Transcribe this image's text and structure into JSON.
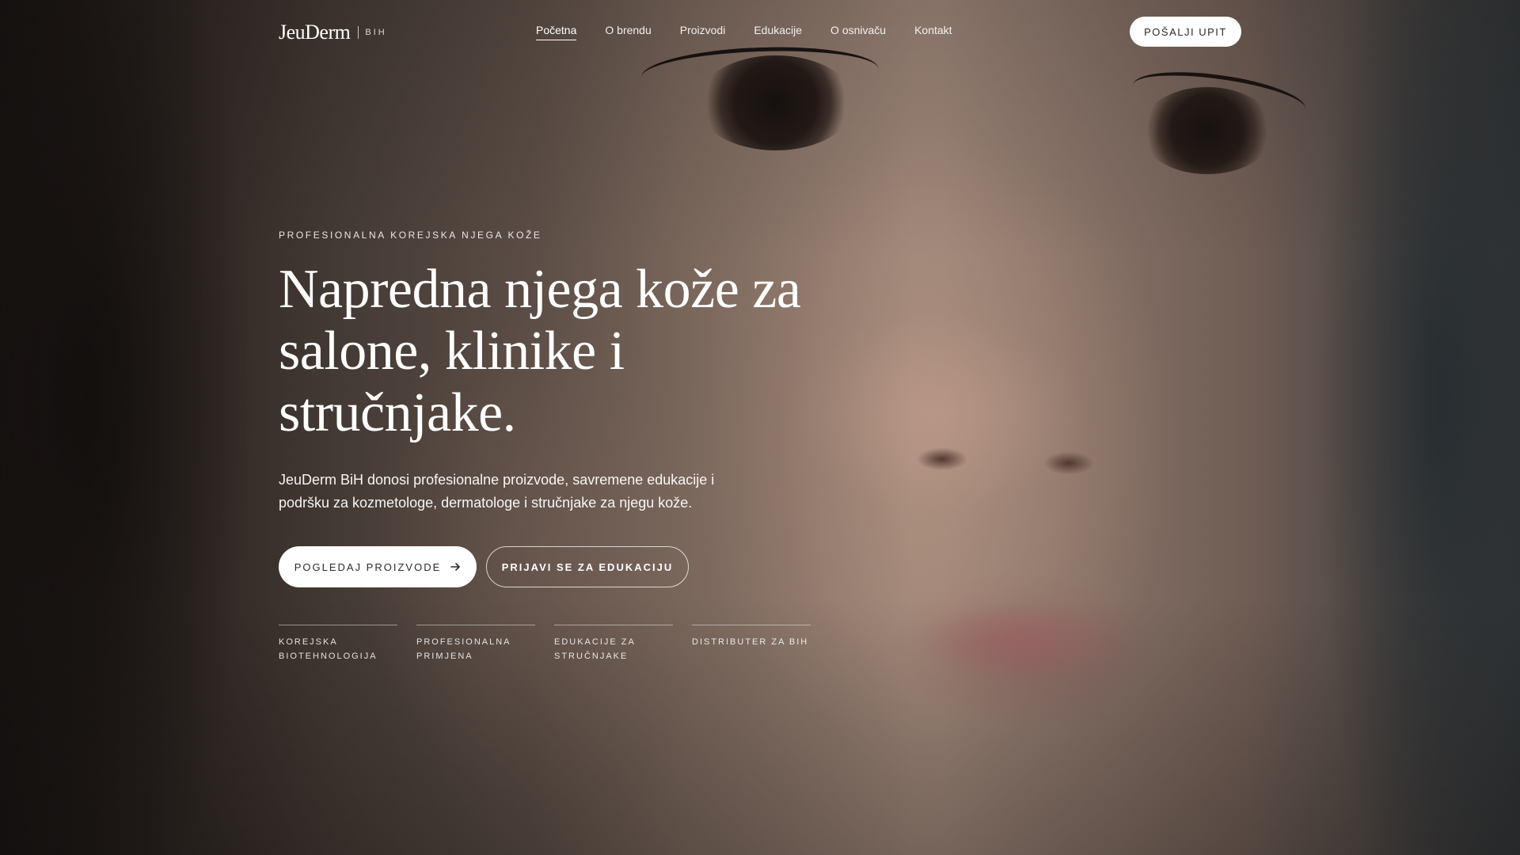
{
  "brand": {
    "name": "JeuDerm",
    "region": "BIH"
  },
  "nav": {
    "items": [
      {
        "label": "Početna",
        "active": true
      },
      {
        "label": "O brendu",
        "active": false
      },
      {
        "label": "Proizvodi",
        "active": false
      },
      {
        "label": "Edukacije",
        "active": false
      },
      {
        "label": "O osnivaču",
        "active": false
      },
      {
        "label": "Kontakt",
        "active": false
      }
    ],
    "cta_label": "POŠALJI UPIT"
  },
  "hero": {
    "eyebrow": "PROFESIONALNA KOREJSKA NJEGA KOŽE",
    "headline": "Napredna njega kože za salone, klinike i stručnjake.",
    "lead": "JeuDerm BiH donosi profesionalne proizvode, savremene edukacije i podršku za kozmetologe, dermatologe i stručnjake za njegu kože.",
    "primary_button": {
      "label": "POGLEDAJ PROIZVODE",
      "icon": "arrow-right-icon"
    },
    "secondary_button": {
      "label": "PRIJAVI SE ZA EDUKACIJU"
    },
    "features": [
      "KOREJSKA BIOTEHNOLOGIJA",
      "PROFESIONALNA PRIMJENA",
      "EDUKACIJE ZA STRUČNJAKE",
      "DISTRIBUTER ZA BIH"
    ]
  },
  "colors": {
    "text_on_image": "#ffffff",
    "button_bg": "#ffffff",
    "button_text": "#2b2b2b"
  }
}
